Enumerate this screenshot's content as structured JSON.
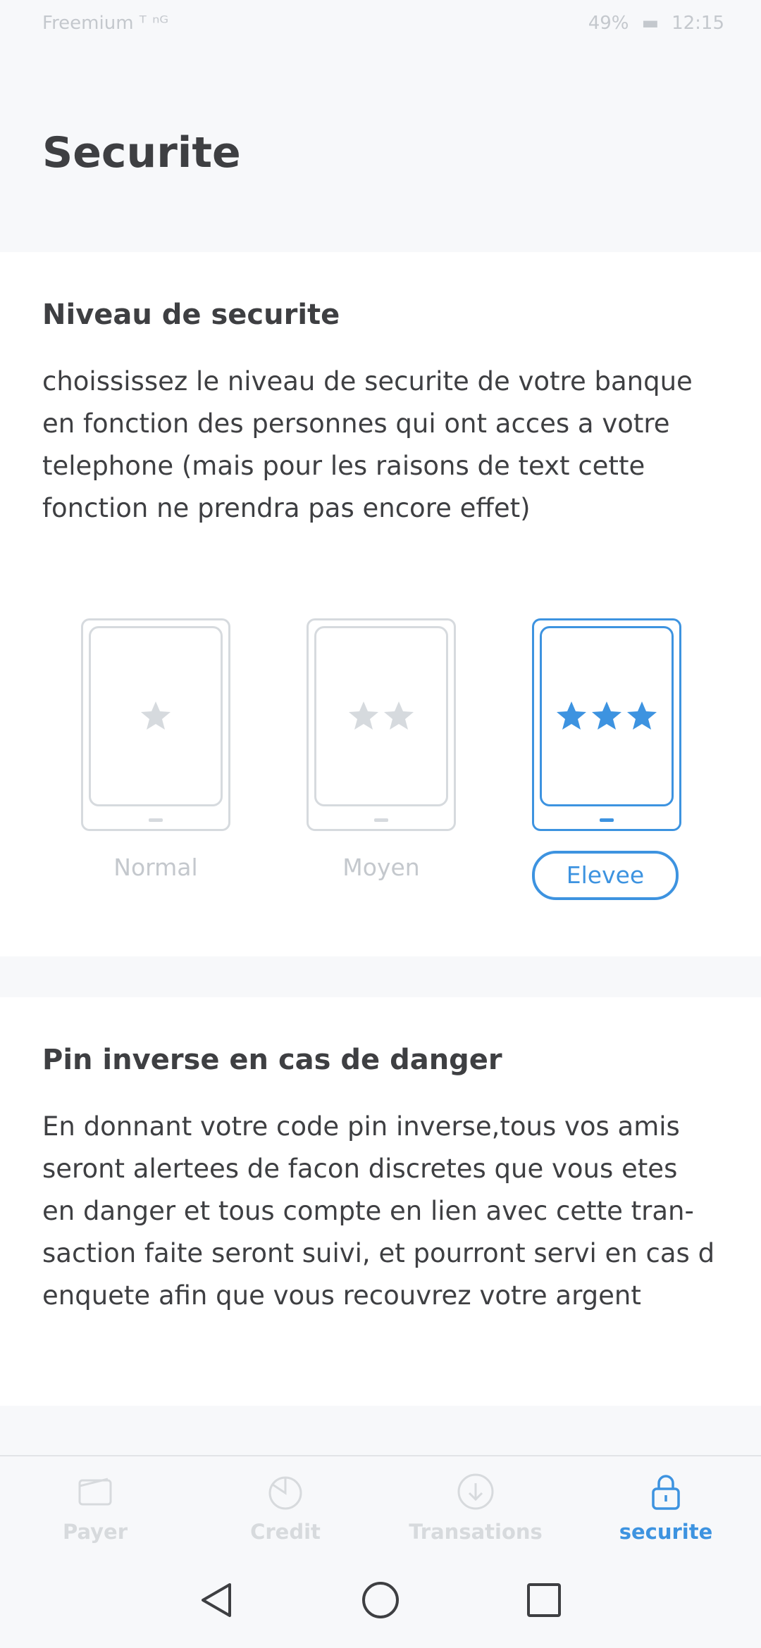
{
  "status_bar": {
    "left": "Freemium ᵀ  ⁿᴳ",
    "battery": "49%",
    "time": "12:15"
  },
  "page": {
    "title": "Securite"
  },
  "security_level": {
    "title": "Niveau de securite",
    "description": "choississez le niveau de securite de votre banque en fonction des personnes qui ont acces a votre telephone (mais pour les raisons de text cette fonction ne prendra pas encore effet)",
    "levels": [
      {
        "label": "Normal",
        "stars": 1
      },
      {
        "label": "Moyen",
        "stars": 2
      },
      {
        "label": "Elevee",
        "stars": 3
      }
    ],
    "selected": "Elevee",
    "accent_color": "#3d93e0",
    "inactive_color": "#d6dade"
  },
  "pin_section": {
    "title": "Pin inverse en cas de danger",
    "description_lines": [
      "En donnant votre code pin inverse,tous vos amis",
      "seront alertees de facon discretes que vous etes",
      "en danger et tous compte en lien avec cette tran-",
      "saction faite seront suivi, et pourront servi en cas d",
      "enquete afin que vous recouvrez votre argent"
    ]
  },
  "bottom_nav": {
    "items": [
      {
        "label": "Payer",
        "icon": "wallet-icon"
      },
      {
        "label": "Credit",
        "icon": "pie-chart-icon"
      },
      {
        "label": "Transations",
        "icon": "download-circle-icon"
      },
      {
        "label": "securite",
        "icon": "lock-icon"
      }
    ],
    "active": "securite"
  },
  "system_nav": {
    "icons": [
      "back-triangle-icon",
      "home-circle-icon",
      "recents-square-icon"
    ]
  }
}
